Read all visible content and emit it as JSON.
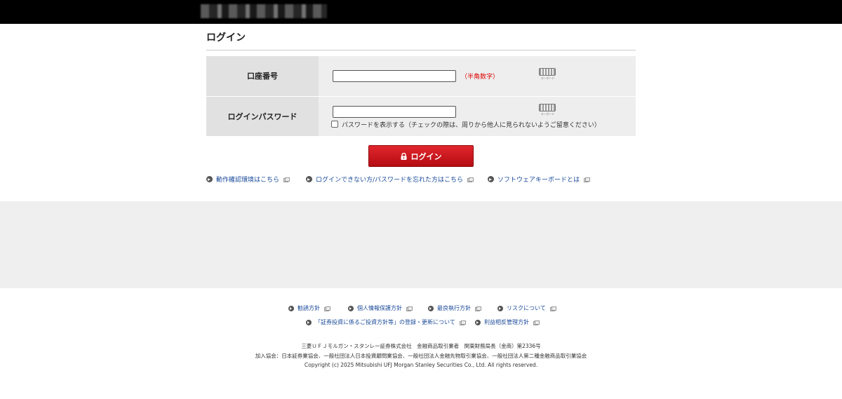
{
  "header": {
    "logo_alt": "blurred-logo"
  },
  "page": {
    "title": "ログイン"
  },
  "form": {
    "account_label": "口座番号",
    "account_value": "",
    "account_hint": "（半角数字）",
    "password_label": "ログインパスワード",
    "password_value": "",
    "keyboard_caption": "キーボード",
    "show_password_label": "パスワードを表示する（チェックの際は、周りから他人に見られないようご留意ください）",
    "login_button": "ログイン"
  },
  "links": [
    {
      "label": "動作確認環境はこちら"
    },
    {
      "label": "ログインできない方/パスワードを忘れた方はこちら"
    },
    {
      "label": "ソフトウェアキーボードとは"
    }
  ],
  "footer": {
    "links": [
      {
        "label": "勧誘方針"
      },
      {
        "label": "個人情報保護方針"
      },
      {
        "label": "最良執行方針"
      },
      {
        "label": "リスクについて"
      },
      {
        "label": "「証券投資に係るご投資方針等」の登録・更新について"
      },
      {
        "label": "利益相反管理方針"
      }
    ],
    "company": "三菱ＵＦＪモルガン・スタンレー証券株式会社　金融商品取引業者　関東財務局長（金商）第2336号",
    "associations": "加入協会：日本証券業協会、一般社団法人日本投資顧問業協会、一般社団法人金融先物取引業協会、一般社団法人第二種金融商品取引業協会",
    "copyright": "Copyright (c) 2025 Mitsubishi UFJ Morgan Stanley Securities Co., Ltd. All rights reserved."
  },
  "colors": {
    "accent": "#c8161d",
    "link": "#1a4a9a",
    "hint": "#dd0000"
  }
}
